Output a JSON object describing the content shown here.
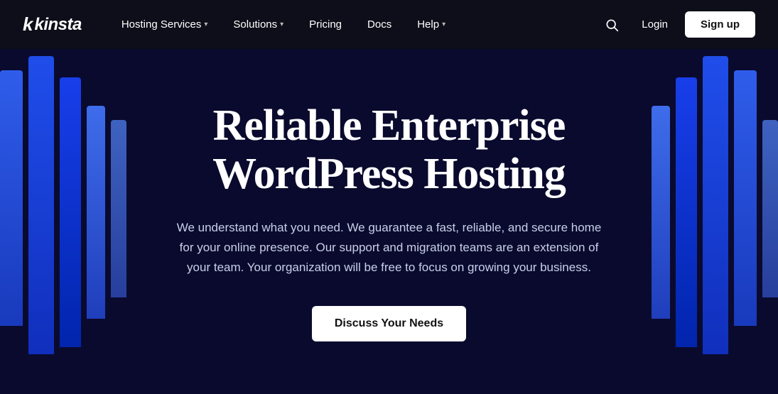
{
  "brand": {
    "name": "kinsta",
    "logo_label": "kinsta"
  },
  "navbar": {
    "links": [
      {
        "label": "Hosting Services",
        "has_dropdown": true
      },
      {
        "label": "Solutions",
        "has_dropdown": true
      },
      {
        "label": "Pricing",
        "has_dropdown": false
      },
      {
        "label": "Docs",
        "has_dropdown": false
      },
      {
        "label": "Help",
        "has_dropdown": true
      }
    ],
    "login_label": "Login",
    "signup_label": "Sign up"
  },
  "hero": {
    "title_line1": "Reliable Enterprise",
    "title_line2": "WordPress Hosting",
    "subtitle": "We understand what you need. We guarantee a fast, reliable, and secure home for your online presence. Our support and migration teams are an extension of your team. Your organization will be free to focus on growing your business.",
    "cta_label": "Discuss Your Needs"
  },
  "colors": {
    "navbar_bg": "#0e0e1a",
    "hero_bg": "#0a0a2e",
    "accent_blue": "#2255ff",
    "text_white": "#ffffff",
    "text_muted": "#c8cfe8"
  }
}
